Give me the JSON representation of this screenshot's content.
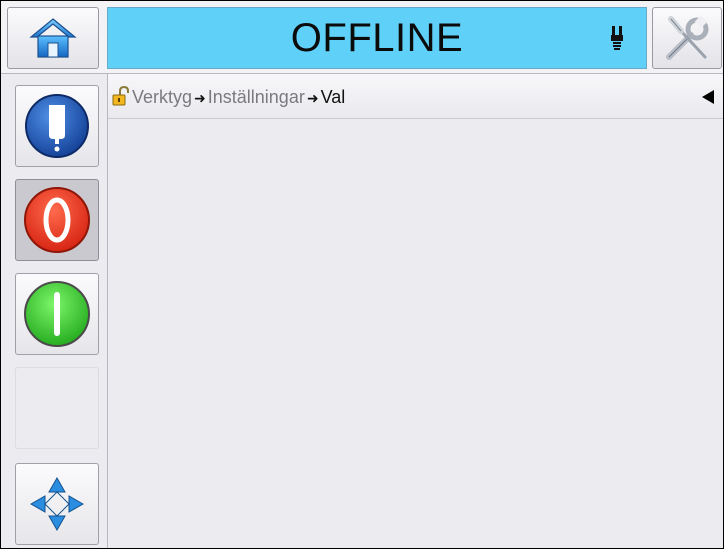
{
  "header": {
    "status": "OFFLINE"
  },
  "breadcrumb": {
    "items": [
      "Verktyg",
      "Inställningar",
      "Val"
    ]
  },
  "colors": {
    "status_bg": "#5fd0f7",
    "stop_red": "#e2321f",
    "start_green": "#39c832",
    "ink_blue": "#1d57b8"
  },
  "icons": {
    "home": "home-icon",
    "tools": "tools-icon",
    "printhead": "printhead-icon",
    "ink": "ink-cartridge-icon",
    "stop": "stop-icon",
    "start": "start-icon",
    "navigate": "navigation-arrows-icon",
    "lock": "unlocked-padlock-icon",
    "back": "back-arrow-icon"
  }
}
